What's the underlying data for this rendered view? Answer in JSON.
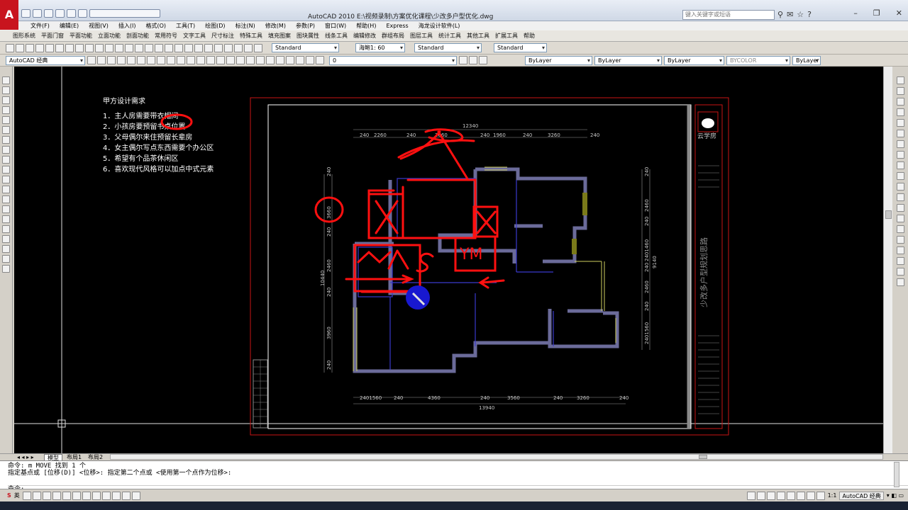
{
  "app": {
    "logo": "A",
    "title": "AutoCAD 2010      E:\\视频录制\\方案优化课程\\少改多户型优化.dwg",
    "search_placeholder": "键入关键字或短语"
  },
  "menu": [
    "文件(F)",
    "编辑(E)",
    "视图(V)",
    "插入(I)",
    "格式(O)",
    "工具(T)",
    "绘图(D)",
    "标注(N)",
    "修改(M)",
    "参数(P)",
    "窗口(W)",
    "帮助(H)",
    "Express",
    "海龙设计软件(L)"
  ],
  "menu2": [
    "图形系统",
    "平面门窗",
    "平面功能",
    "立面功能",
    "剖面功能",
    "常用符号",
    "文字工具",
    "尺寸标注",
    "特殊工具",
    "填充图案",
    "图块属性",
    "线条工具",
    "编辑修改",
    "群组布局",
    "图层工具",
    "统计工具",
    "其他工具",
    "扩展工具",
    "帮助"
  ],
  "toolbar1": {
    "text_style": "Standard",
    "scale": "海鲍1: 60",
    "dim_style": "Standard",
    "table_style": "Standard"
  },
  "toolbar2": {
    "workspace": "AutoCAD 经典",
    "layer": "0",
    "color": "ByLayer",
    "linetype": "ByLayer",
    "lineweight": "ByLayer",
    "plotstyle": "BYCOLOR",
    "plotstyle2": "ByLayer"
  },
  "requirements": {
    "title": "甲方设计需求",
    "items": [
      "1．主人房需要带衣帽间",
      "2．小孩房要预留书桌位置",
      "3．父母偶尔来住预留长辈房",
      "4．女主偶尔写点东西需要个办公区",
      "5．希望有个品茶休闲区",
      "6．喜欢现代风格可以加点中式元素"
    ]
  },
  "drawing": {
    "top_total": "12340",
    "top_dims": [
      "240",
      "2260",
      "240",
      "3660",
      "240",
      "1960",
      "240",
      "3260",
      "240"
    ],
    "bottom_total": "13940",
    "bottom_dims": [
      "2401560",
      "240",
      "4360",
      "240",
      "3560",
      "240",
      "3260",
      "240"
    ],
    "left_total": "10440",
    "left_dims": [
      "240",
      "3660",
      "240",
      "2460",
      "240",
      "3960",
      "240"
    ],
    "right_total": "9140",
    "right_dims": [
      "240",
      "2460",
      "240",
      "2401460",
      "240",
      "2460",
      "240",
      "2401560"
    ],
    "annot_ym": "YM",
    "titleblock_logo": "云学房",
    "titleblock_vertical": "少改多户型规划思路"
  },
  "tabs": [
    "模型",
    "布局1",
    "布局2"
  ],
  "command": {
    "line1": "命令: m MOVE 找到 1 个",
    "line2": "指定基点或 [位移(D)] <位移>:  指定第二个点或 <使用第一个点作为位移>:",
    "prompt": "命令:"
  },
  "status": {
    "ime": "英",
    "scale": "1:1",
    "workspace": "AutoCAD 经典"
  },
  "colors": {
    "brand": "#c8141e",
    "canvas": "#000000",
    "wall": "#6b6b9a",
    "markup": "#ff0000"
  }
}
